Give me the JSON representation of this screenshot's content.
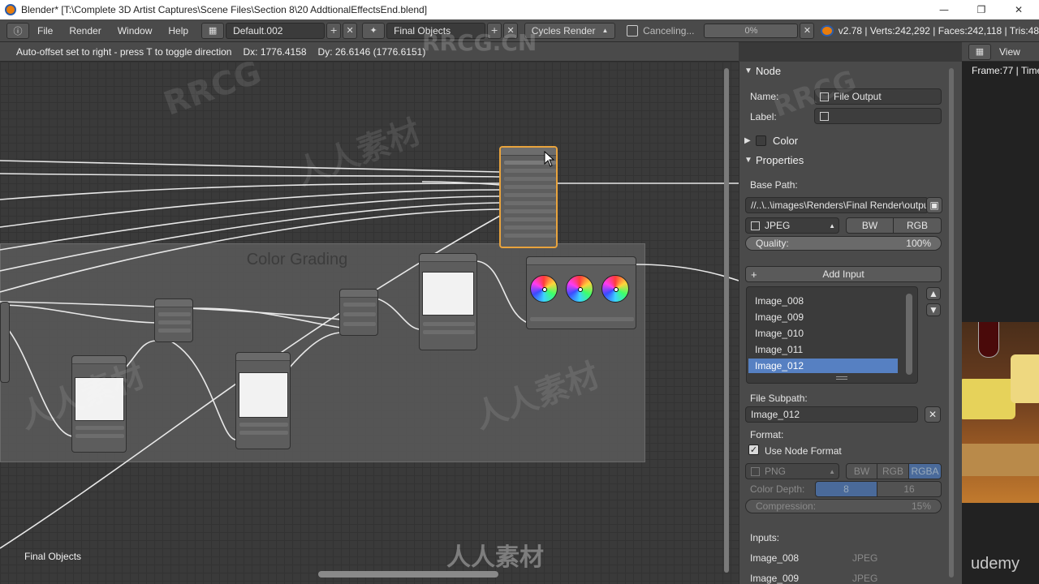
{
  "window": {
    "title": "Blender* [T:\\Complete 3D Artist Captures\\Scene Files\\Section 8\\20 AddtionalEffectsEnd.blend]"
  },
  "menu": [
    "File",
    "Render",
    "Window",
    "Help"
  ],
  "screen_layout": "Default.002",
  "scene": "Final Objects",
  "engine": "Cycles Render",
  "job": {
    "label": "Canceling...",
    "progress_text": "0%",
    "progress": 0
  },
  "stats": "v2.78 | Verts:242,292 | Faces:242,118 | Tris:48",
  "node_editor": {
    "status": "Auto-offset set to right - press T to toggle direction",
    "dx": "Dx: 1776.4158",
    "dy": "Dy: 26.6146 (1776.6151)",
    "frame_label": "Color Grading",
    "view_label": "Final Objects"
  },
  "panel": {
    "node_section": "Node",
    "name_label": "Name:",
    "name_value": "File Output",
    "label_label": "Label:",
    "label_value": "",
    "color_section": "Color",
    "properties_section": "Properties",
    "base_path_label": "Base Path:",
    "base_path_value": "//..\\..\\images\\Renders\\Final Render\\output...",
    "file_format": "JPEG",
    "bw": "BW",
    "rgb": "RGB",
    "quality_label": "Quality:",
    "quality_value": "100%",
    "add_input": "Add Input",
    "inputs_list": [
      "Image_008",
      "Image_009",
      "Image_010",
      "Image_011",
      "Image_012"
    ],
    "active_input": "Image_012",
    "file_subpath_label": "File Subpath:",
    "file_subpath_value": "Image_012",
    "format_label": "Format:",
    "use_node_format": "Use Node Format",
    "sub_format": "PNG",
    "sub_bw": "BW",
    "sub_rgb": "RGB",
    "sub_rgba": "RGBA",
    "color_depth_label": "Color Depth:",
    "color_depth_8": "8",
    "color_depth_16": "16",
    "compression_label": "Compression:",
    "compression_value": "15%",
    "inputs_label": "Inputs:",
    "inputs_rows": [
      {
        "name": "Image_008",
        "format": "JPEG"
      },
      {
        "name": "Image_009",
        "format": "JPEG"
      }
    ]
  },
  "preview": {
    "view_label": "View",
    "frame_info": "Frame:77 | Time"
  },
  "watermarks": {
    "main": "RRCG.CN",
    "chinese": "人人素材",
    "latin": "RRCG",
    "brand": "udemy"
  },
  "colors": {
    "accent_selected": "#5680c2",
    "node_selected_border": "#e8a33d",
    "panel_bg": "#4a4a4a",
    "canvas_bg": "#3a3a3a"
  }
}
